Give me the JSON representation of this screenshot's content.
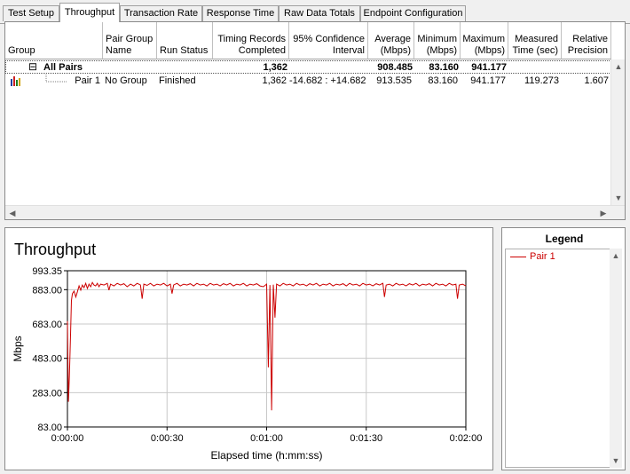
{
  "tabs": [
    {
      "label": "Test Setup"
    },
    {
      "label": "Throughput"
    },
    {
      "label": "Transaction Rate"
    },
    {
      "label": "Response Time"
    },
    {
      "label": "Raw Data Totals"
    },
    {
      "label": "Endpoint Configuration"
    }
  ],
  "columns": [
    {
      "label": "Group"
    },
    {
      "label": "Pair Group\nName"
    },
    {
      "label": "Run Status"
    },
    {
      "label": "Timing Records\nCompleted"
    },
    {
      "label": "95% Confidence\nInterval"
    },
    {
      "label": "Average\n(Mbps)"
    },
    {
      "label": "Minimum\n(Mbps)"
    },
    {
      "label": "Maximum\n(Mbps)"
    },
    {
      "label": "Measured\nTime (sec)"
    },
    {
      "label": "Relative\nPrecision"
    }
  ],
  "summary_row": {
    "expander": "⊟",
    "group": "All Pairs",
    "records": "1,362",
    "average": "908.485",
    "minimum": "83.160",
    "maximum": "941.177"
  },
  "pair_row": {
    "group": "Pair 1",
    "pair_group_name": "No Group",
    "run_status": "Finished",
    "records": "1,362",
    "confidence": "-14.682 : +14.682",
    "average": "913.535",
    "minimum": "83.160",
    "maximum": "941.177",
    "measured_time": "119.273",
    "precision": "1.607"
  },
  "scroll_arrows": {
    "up": "▲",
    "down": "▼",
    "left": "◀",
    "right": "▶"
  },
  "chart_data": {
    "type": "line",
    "title": "Throughput",
    "xlabel": "Elapsed time (h:mm:ss)",
    "ylabel": "Mbps",
    "xlim": [
      0,
      120
    ],
    "ylim": [
      83.0,
      993.35
    ],
    "y_ticks": [
      "993.35",
      "883.00",
      "683.00",
      "483.00",
      "283.00",
      "83.00"
    ],
    "y_tick_values": [
      993.35,
      883.0,
      683.0,
      483.0,
      283.0,
      83.0
    ],
    "x_ticks": [
      "0:00:00",
      "0:00:30",
      "0:01:00",
      "0:01:30",
      "0:02:00"
    ],
    "x_tick_values": [
      0,
      30,
      60,
      90,
      120
    ],
    "grid": true,
    "series": [
      {
        "name": "Pair 1",
        "color": "#cc0000",
        "points": [
          [
            0.0,
            700
          ],
          [
            0.3,
            230
          ],
          [
            0.6,
            380
          ],
          [
            0.9,
            600
          ],
          [
            1.2,
            820
          ],
          [
            1.5,
            860
          ],
          [
            2.0,
            875
          ],
          [
            2.5,
            840
          ],
          [
            3.0,
            870
          ],
          [
            3.5,
            905
          ],
          [
            4.0,
            880
          ],
          [
            4.5,
            910
          ],
          [
            5.0,
            895
          ],
          [
            5.5,
            920
          ],
          [
            6.0,
            890
          ],
          [
            6.5,
            915
          ],
          [
            7.0,
            900
          ],
          [
            7.5,
            925
          ],
          [
            8.0,
            910
          ],
          [
            8.5,
            905
          ],
          [
            9.0,
            920
          ],
          [
            9.5,
            900
          ],
          [
            10.0,
            915
          ],
          [
            11.0,
            910
          ],
          [
            12.0,
            920
          ],
          [
            12.5,
            880
          ],
          [
            13.0,
            915
          ],
          [
            14.0,
            905
          ],
          [
            15.0,
            920
          ],
          [
            16.0,
            910
          ],
          [
            17.0,
            918
          ],
          [
            18.0,
            900
          ],
          [
            19.0,
            915
          ],
          [
            20.0,
            905
          ],
          [
            21.0,
            920
          ],
          [
            22.0,
            910
          ],
          [
            22.5,
            830
          ],
          [
            23.0,
            915
          ],
          [
            24.0,
            908
          ],
          [
            25.0,
            920
          ],
          [
            26.0,
            905
          ],
          [
            27.0,
            915
          ],
          [
            28.0,
            910
          ],
          [
            29.0,
            920
          ],
          [
            30.0,
            905
          ],
          [
            31.0,
            915
          ],
          [
            31.5,
            860
          ],
          [
            32.0,
            910
          ],
          [
            33.0,
            920
          ],
          [
            34.0,
            905
          ],
          [
            35.0,
            915
          ],
          [
            36.0,
            910
          ],
          [
            37.0,
            918
          ],
          [
            38.0,
            905
          ],
          [
            39.0,
            920
          ],
          [
            40.0,
            910
          ],
          [
            41.0,
            915
          ],
          [
            42.0,
            905
          ],
          [
            43.0,
            920
          ],
          [
            44.0,
            910
          ],
          [
            45.0,
            915
          ],
          [
            46.0,
            905
          ],
          [
            47.0,
            918
          ],
          [
            48.0,
            910
          ],
          [
            49.0,
            920
          ],
          [
            50.0,
            905
          ],
          [
            51.0,
            915
          ],
          [
            52.0,
            910
          ],
          [
            53.0,
            920
          ],
          [
            54.0,
            905
          ],
          [
            55.0,
            915
          ],
          [
            56.0,
            910
          ],
          [
            57.0,
            918
          ],
          [
            58.0,
            905
          ],
          [
            59.0,
            900
          ],
          [
            60.0,
            915
          ],
          [
            60.5,
            430
          ],
          [
            61.0,
            910
          ],
          [
            61.5,
            180
          ],
          [
            62.0,
            912
          ],
          [
            62.5,
            720
          ],
          [
            63.0,
            915
          ],
          [
            64.0,
            905
          ],
          [
            65.0,
            920
          ],
          [
            66.0,
            910
          ],
          [
            67.0,
            915
          ],
          [
            68.0,
            905
          ],
          [
            69.0,
            920
          ],
          [
            70.0,
            910
          ],
          [
            71.0,
            915
          ],
          [
            72.0,
            905
          ],
          [
            73.0,
            918
          ],
          [
            74.0,
            910
          ],
          [
            75.0,
            920
          ],
          [
            76.0,
            905
          ],
          [
            77.0,
            915
          ],
          [
            78.0,
            910
          ],
          [
            79.0,
            920
          ],
          [
            80.0,
            905
          ],
          [
            81.0,
            915
          ],
          [
            82.0,
            910
          ],
          [
            83.0,
            918
          ],
          [
            84.0,
            905
          ],
          [
            85.0,
            920
          ],
          [
            86.0,
            910
          ],
          [
            87.0,
            915
          ],
          [
            88.0,
            905
          ],
          [
            89.0,
            920
          ],
          [
            90.0,
            910
          ],
          [
            91.0,
            915
          ],
          [
            92.0,
            905
          ],
          [
            93.0,
            918
          ],
          [
            94.0,
            910
          ],
          [
            95.0,
            920
          ],
          [
            95.5,
            840
          ],
          [
            96.0,
            910
          ],
          [
            97.0,
            915
          ],
          [
            98.0,
            905
          ],
          [
            99.0,
            920
          ],
          [
            100.0,
            910
          ],
          [
            101.0,
            915
          ],
          [
            102.0,
            905
          ],
          [
            103.0,
            918
          ],
          [
            104.0,
            910
          ],
          [
            105.0,
            920
          ],
          [
            106.0,
            905
          ],
          [
            107.0,
            915
          ],
          [
            108.0,
            910
          ],
          [
            109.0,
            918
          ],
          [
            110.0,
            905
          ],
          [
            111.0,
            920
          ],
          [
            112.0,
            910
          ],
          [
            113.0,
            915
          ],
          [
            114.0,
            905
          ],
          [
            115.0,
            920
          ],
          [
            116.0,
            910
          ],
          [
            117.0,
            915
          ],
          [
            117.5,
            830
          ],
          [
            118.0,
            910
          ],
          [
            119.0,
            915
          ],
          [
            120.0,
            905
          ]
        ]
      }
    ]
  },
  "legend": {
    "title": "Legend",
    "items": [
      {
        "label": "Pair 1",
        "color": "#cc0000"
      }
    ]
  }
}
